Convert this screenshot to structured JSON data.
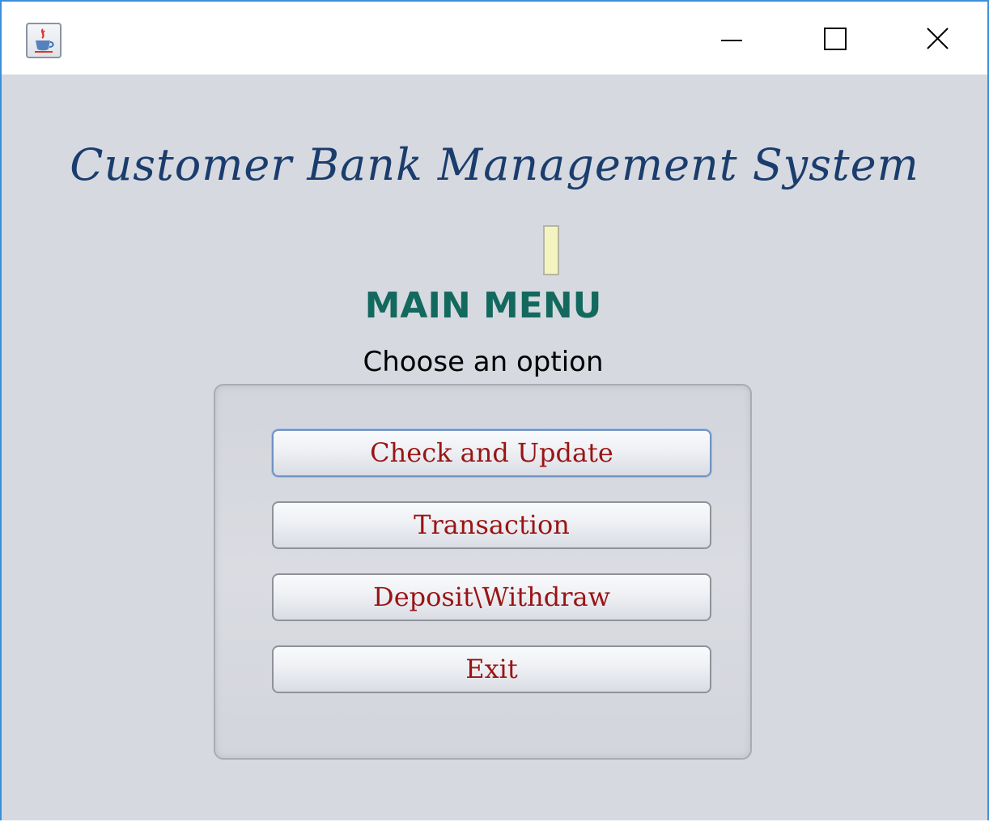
{
  "window": {
    "icon": "java-coffee-cup-icon",
    "controls": {
      "minimize": "minimize-icon",
      "maximize": "maximize-icon",
      "close": "close-icon"
    }
  },
  "app": {
    "title": "Customer Bank Management System",
    "heading": "MAIN MENU",
    "subheading": "Choose an option"
  },
  "menu": {
    "buttons": [
      {
        "label": "Check and Update",
        "focused": true
      },
      {
        "label": "Transaction",
        "focused": false
      },
      {
        "label": "Deposit\\Withdraw",
        "focused": false
      },
      {
        "label": "Exit",
        "focused": false
      }
    ]
  },
  "colors": {
    "title": "#1a3d6d",
    "heading": "#13695e",
    "button_text": "#9a1414",
    "background": "#d6d9e0",
    "window_border": "#3c8fd8"
  }
}
